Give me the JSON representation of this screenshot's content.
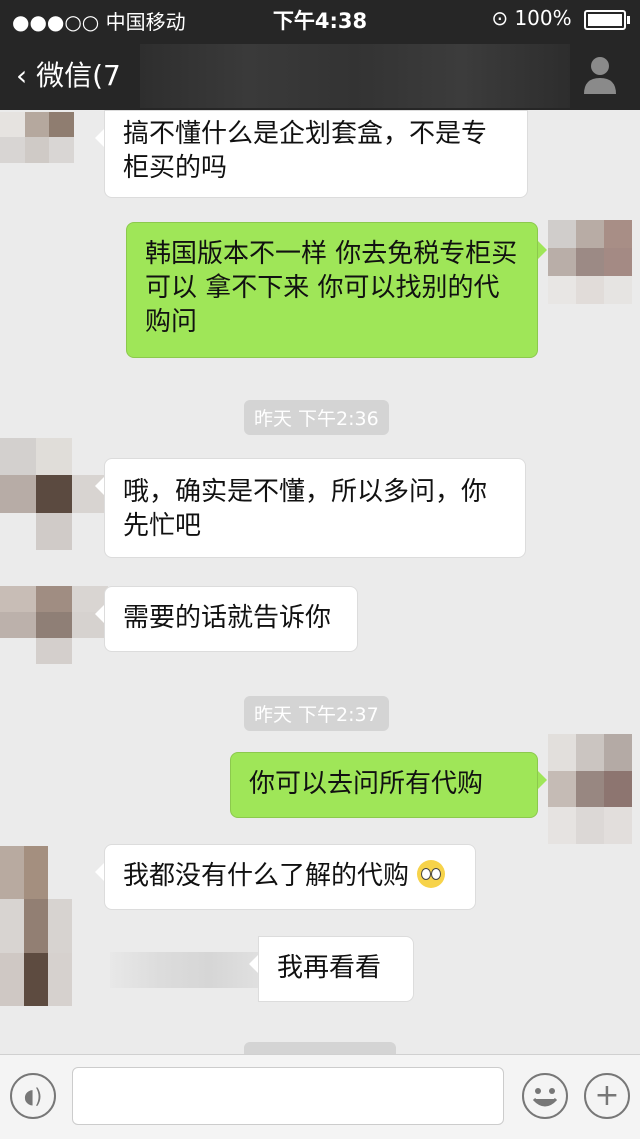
{
  "status": {
    "carrier": "●●●○○ 中国移动",
    "time": "下午4:38",
    "battery": "100%"
  },
  "nav": {
    "back_label": "微信(7"
  },
  "messages": [
    {
      "text": "搞不懂什么是企划套盒，不是专柜买的吗"
    },
    {
      "text": "韩国版本不一样  你去免税专柜买可以        拿不下来  你可以找别的代购问"
    },
    {
      "time": "昨天  下午2:36"
    },
    {
      "text": "哦，确实是不懂，所以多问，你先忙吧"
    },
    {
      "text": "需要的话就告诉你"
    },
    {
      "time": "昨天  下午2:37"
    },
    {
      "text": "你可以去问所有代购"
    },
    {
      "text": "我都没有什么了解的代购"
    },
    {
      "text": "我再看看"
    }
  ],
  "colors": {
    "out_bubble": "#9fe658",
    "in_bubble": "#ffffff",
    "background": "#ebebeb",
    "topbar": "#262626"
  },
  "icons": [
    "back-chevron-icon",
    "profile-icon",
    "voice-icon",
    "emoji-icon",
    "add-icon",
    "wifi-icon",
    "lock-icon",
    "battery-icon"
  ]
}
